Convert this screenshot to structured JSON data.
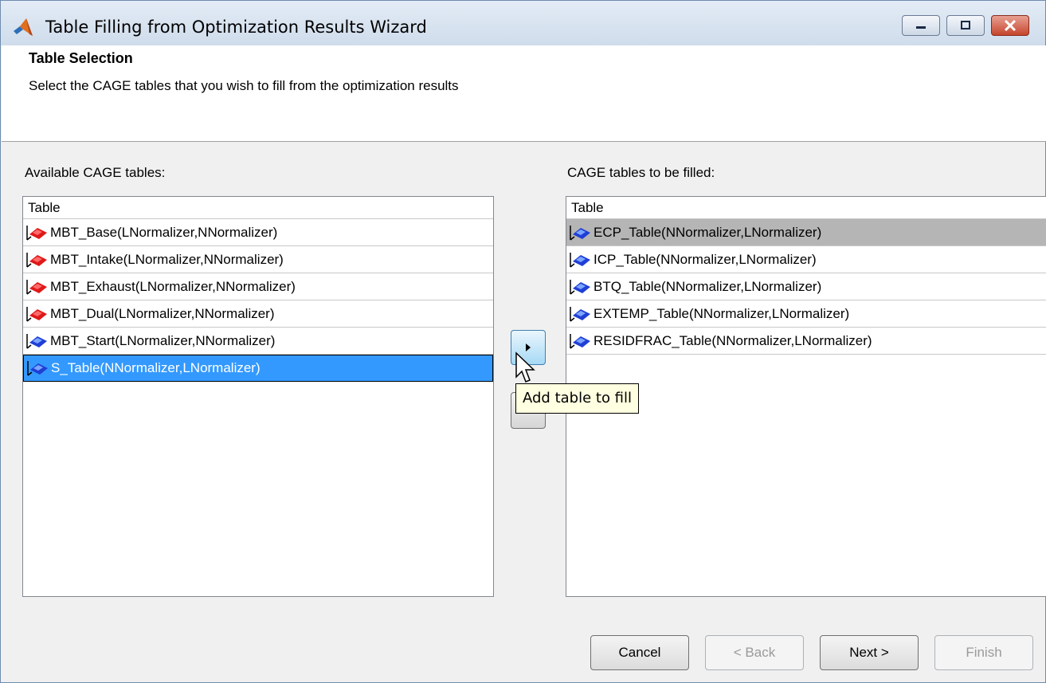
{
  "window": {
    "title": "Table Filling from Optimization Results Wizard"
  },
  "header": {
    "title": "Table Selection",
    "description": "Select the CAGE tables that you wish to fill from the optimization results"
  },
  "available": {
    "label": "Available CAGE tables:",
    "column_header": "Table",
    "items": [
      {
        "label": "MBT_Base(LNormalizer,NNormalizer)",
        "icon": "red-table-icon"
      },
      {
        "label": "MBT_Intake(LNormalizer,NNormalizer)",
        "icon": "red-table-icon"
      },
      {
        "label": "MBT_Exhaust(LNormalizer,NNormalizer)",
        "icon": "red-table-icon"
      },
      {
        "label": "MBT_Dual(LNormalizer,NNormalizer)",
        "icon": "red-table-icon"
      },
      {
        "label": "MBT_Start(LNormalizer,NNormalizer)",
        "icon": "blue-table-icon"
      },
      {
        "label": "S_Table(NNormalizer,LNormalizer)",
        "icon": "blue-table-icon",
        "selected": true
      }
    ]
  },
  "to_fill": {
    "label": "CAGE tables to be filled:",
    "column_header": "Table",
    "items": [
      {
        "label": "ECP_Table(NNormalizer,LNormalizer)",
        "icon": "blue-table-icon",
        "highlighted": true
      },
      {
        "label": "ICP_Table(NNormalizer,LNormalizer)",
        "icon": "blue-table-icon"
      },
      {
        "label": "BTQ_Table(NNormalizer,LNormalizer)",
        "icon": "blue-table-icon"
      },
      {
        "label": "EXTEMP_Table(NNormalizer,LNormalizer)",
        "icon": "blue-table-icon"
      },
      {
        "label": "RESIDFRAC_Table(NNormalizer,LNormalizer)",
        "icon": "blue-table-icon"
      }
    ]
  },
  "tooltip": "Add table to fill",
  "buttons": {
    "cancel": "Cancel",
    "back": "< Back",
    "next": "Next >",
    "finish": "Finish"
  },
  "colors": {
    "selection": "#3399ff",
    "highlight_row": "#b5b5b5",
    "header_bg": "#ffffff",
    "dialog_bg": "#f0f0f0"
  }
}
